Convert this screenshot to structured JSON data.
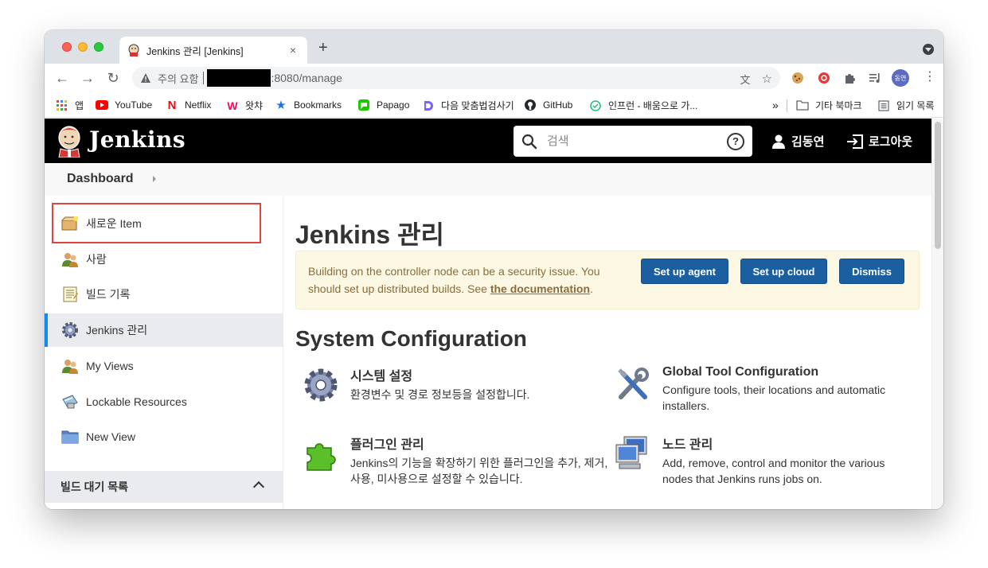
{
  "browser": {
    "tab_title": "Jenkins 관리 [Jenkins]",
    "tab_close": "×",
    "new_tab": "+",
    "address": {
      "security_label": "주의 요함",
      "url_suffix": ":8080/manage"
    },
    "profile_initials": "동연",
    "bookmarks": [
      {
        "label": "앱",
        "icon": "apps-grid-icon"
      },
      {
        "label": "YouTube",
        "icon": "youtube-icon"
      },
      {
        "label": "Netflix",
        "icon": "netflix-icon"
      },
      {
        "label": "왓챠",
        "icon": "watcha-icon"
      },
      {
        "label": "Bookmarks",
        "icon": "star-icon"
      },
      {
        "label": "Papago",
        "icon": "papago-icon"
      },
      {
        "label": "다음 맞춤법검사기",
        "icon": "daum-icon"
      },
      {
        "label": "GitHub",
        "icon": "github-icon"
      },
      {
        "label": "인프런 - 배움으로 가...",
        "icon": "inflearn-icon"
      }
    ],
    "bookmarks_overflow": "»",
    "other_bookmarks": "기타 북마크",
    "reading_list": "읽기 목록"
  },
  "jenkins": {
    "brand": "Jenkins",
    "search_placeholder": "검색",
    "help_label": "?",
    "user_name": "김동연",
    "logout_label": "로그아웃",
    "breadcrumb": "Dashboard",
    "sidebar": [
      {
        "label": "새로운 Item",
        "icon": "new-item-icon"
      },
      {
        "label": "사람",
        "icon": "people-icon"
      },
      {
        "label": "빌드 기록",
        "icon": "build-history-icon"
      },
      {
        "label": "Jenkins 관리",
        "icon": "manage-gear-icon",
        "active": true
      },
      {
        "label": "My Views",
        "icon": "my-views-icon"
      },
      {
        "label": "Lockable Resources",
        "icon": "lockable-resources-icon"
      },
      {
        "label": "New View",
        "icon": "new-view-folder-icon"
      }
    ],
    "build_queue": "빌드 대기 목록",
    "main_title": "Jenkins 관리",
    "alert": {
      "text": "Building on the controller node can be a security issue. You should set up distributed builds. See ",
      "link": "the documentation",
      "suffix": ".",
      "buttons": [
        "Set up agent",
        "Set up cloud",
        "Dismiss"
      ]
    },
    "section_title": "System Configuration",
    "items": [
      {
        "title": "시스템 설정",
        "desc": "환경변수 및 경로 정보등을 설정합니다.",
        "icon": "system-gear-icon"
      },
      {
        "title": "Global Tool Configuration",
        "desc": "Configure tools, their locations and automatic installers.",
        "icon": "tools-icon"
      },
      {
        "title": "플러그인 관리",
        "desc": "Jenkins의 기능을 확장하기 위한 플러그인을 추가, 제거, 사용, 미사용으로 설정할 수 있습니다.",
        "icon": "plugin-puzzle-icon"
      },
      {
        "title": "노드 관리",
        "desc": "Add, remove, control and monitor the various nodes that Jenkins runs jobs on.",
        "icon": "computer-nodes-icon"
      }
    ]
  },
  "colors": {
    "header_bg": "#000000",
    "accent_blue": "#1c5fa0",
    "active_border": "#138af2",
    "alert_bg": "#fcf8e3",
    "alert_text": "#8a6d3b",
    "highlight_red": "#e0443e"
  }
}
